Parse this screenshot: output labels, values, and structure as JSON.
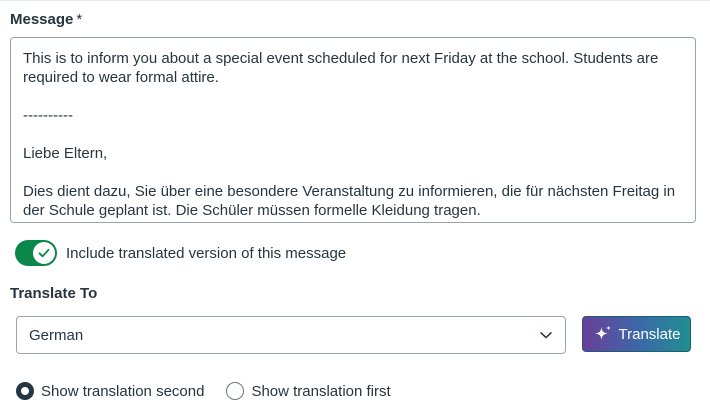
{
  "message": {
    "label": "Message",
    "required_marker": "*",
    "paragraphs": [
      "This is to inform you about a special event scheduled for next Friday at the school. Students are required to wear formal attire.",
      "----------",
      "Liebe Eltern,",
      "Dies dient dazu, Sie über eine besondere Veranstaltung zu informieren, die für nächsten Freitag in der Schule geplant ist. Die Schüler müssen formelle Kleidung tragen."
    ]
  },
  "include_translation": {
    "label": "Include translated version of this message",
    "checked": true,
    "color": "#0b874b",
    "icon": "check-icon"
  },
  "translate_to": {
    "label": "Translate To",
    "selected": "German",
    "icon": "chevron-down-icon"
  },
  "translate_button": {
    "label": "Translate",
    "icon": "sparkle-icon"
  },
  "translation_order": {
    "options": [
      {
        "label": "Show translation second",
        "checked": true
      },
      {
        "label": "Show translation first",
        "checked": false
      }
    ]
  }
}
